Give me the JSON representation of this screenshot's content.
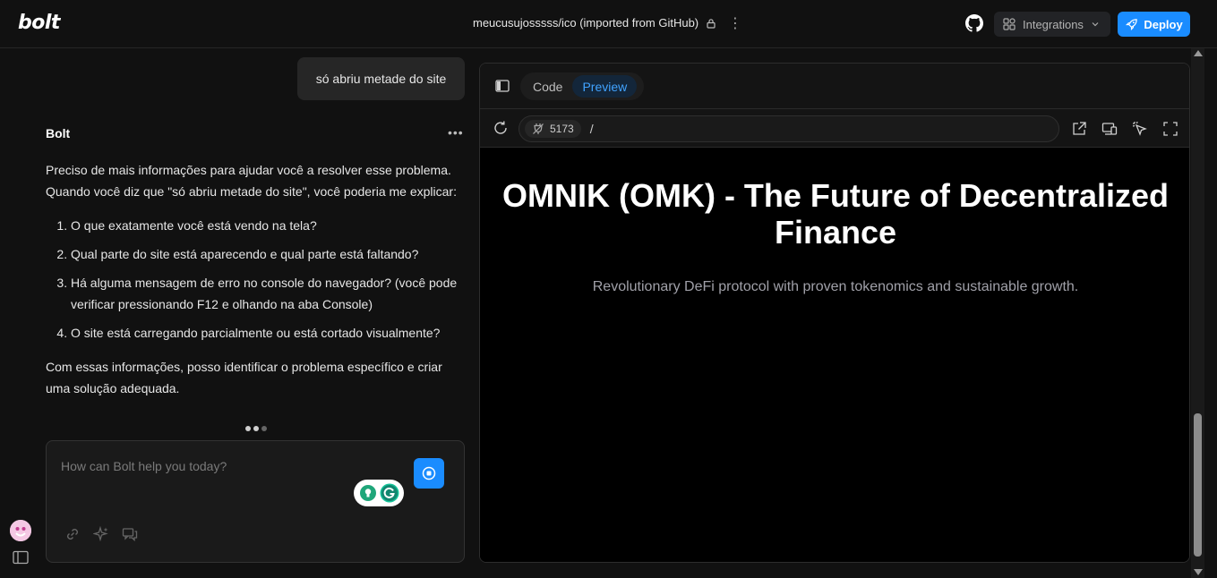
{
  "header": {
    "logo": "bolt",
    "project_title": "meucusujosssss/ico (imported from GitHub)",
    "integrations_label": "Integrations",
    "deploy_label": "Deploy"
  },
  "chat": {
    "user_message": "só abriu metade do site",
    "bot_name": "Bolt",
    "bot_intro": "Preciso de mais informações para ajudar você a resolver esse problema. Quando você diz que \"só abriu metade do site\", você poderia me explicar:",
    "bot_list": [
      "O que exatamente você está vendo na tela?",
      "Qual parte do site está aparecendo e qual parte está faltando?",
      "Há alguma mensagem de erro no console do navegador? (você pode verificar pressionando F12 e olhando na aba Console)",
      "O site está carregando parcialmente ou está cortado visualmente?"
    ],
    "bot_outro": "Com essas informações, posso identificar o problema específico e criar uma solução adequada.",
    "input_placeholder": "How can Bolt help you today?"
  },
  "preview": {
    "tabs": [
      "Code",
      "Preview"
    ],
    "active_tab": "Preview",
    "port": "5173",
    "path": "/",
    "hero_title": "OMNIK (OMK) - The Future of Decentralized Finance",
    "hero_subtitle": "Revolutionary DeFi protocol with proven tokenomics and sustainable growth."
  },
  "colors": {
    "accent": "#1a8cff",
    "background": "#111111",
    "preview_bg": "#000000"
  }
}
